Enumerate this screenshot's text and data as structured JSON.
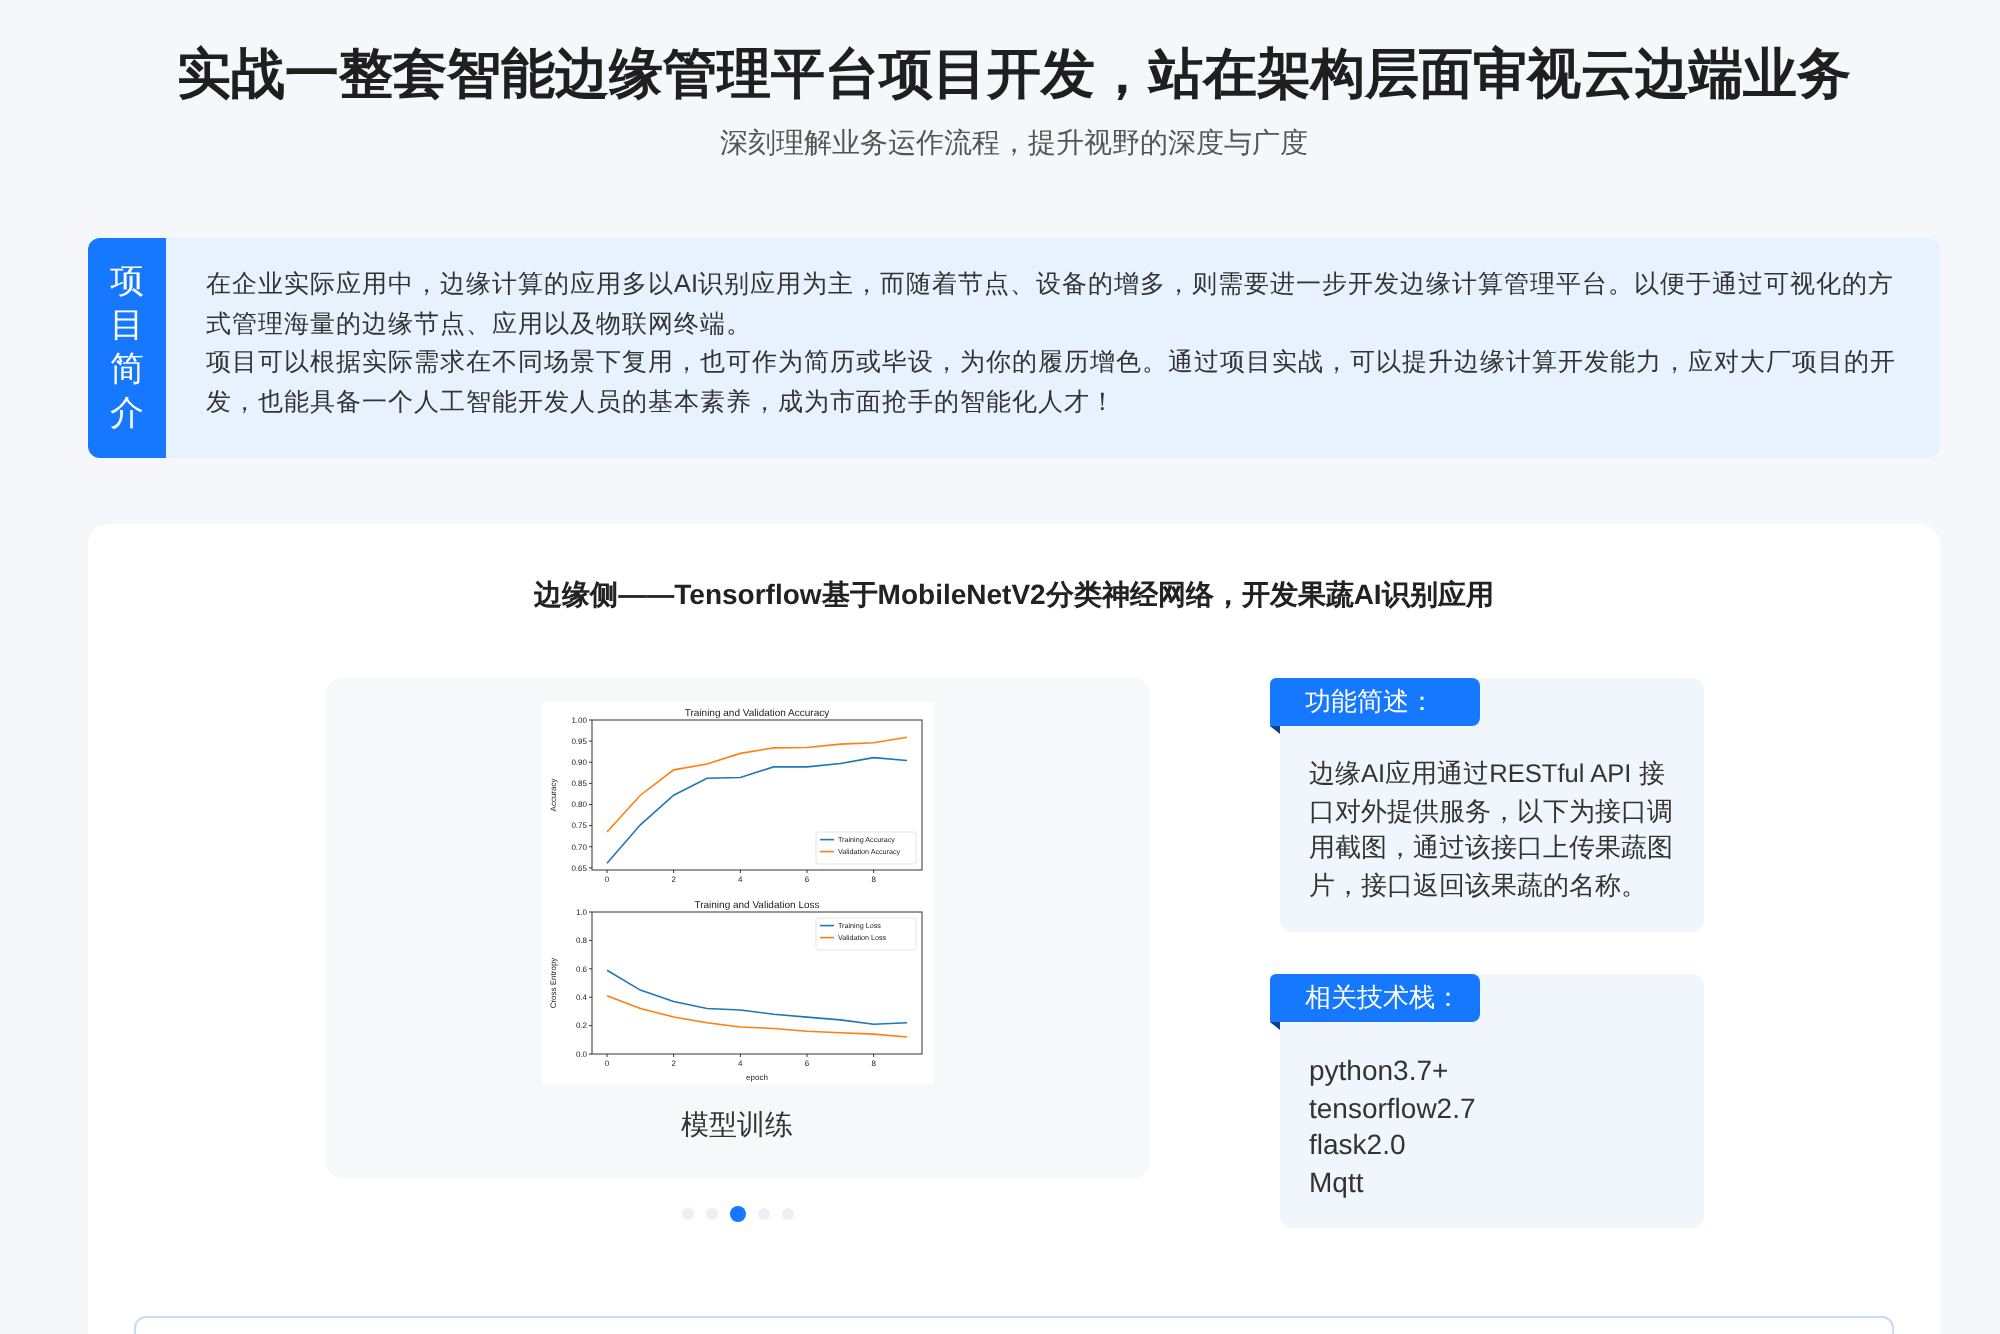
{
  "header": {
    "title": "实战一整套智能边缘管理平台项目开发，站在架构层面审视云边端业务",
    "subtitle": "深刻理解业务运作流程，提升视野的深度与广度"
  },
  "intro": {
    "label": "项目简介",
    "paragraphs": [
      "在企业实际应用中，边缘计算的应用多以AI识别应用为主，而随着节点、设备的增多，则需要进一步开发边缘计算管理平台。以便于通过可视化的方式管理海量的边缘节点、应用以及物联网终端。",
      "项目可以根据实际需求在不同场景下复用，也可作为简历或毕设，为你的履历增色。通过项目实战，可以提升边缘计算开发能力，应对大厂项目的开发，也能具备一个人工智能开发人员的基本素养，成为市面抢手的智能化人才！"
    ]
  },
  "section": {
    "title": "边缘侧——Tensorflow基于MobileNetV2分类神经网络，开发果蔬AI识别应用",
    "slide": {
      "charts": [
        {
          "chart_data": {
            "type": "line",
            "title": "Training and Validation Accuracy",
            "ylabel": "Accuracy",
            "x": [
              0,
              1,
              2,
              3,
              4,
              5,
              6,
              7,
              8,
              9
            ],
            "series": [
              {
                "name": "Training Accuracy",
                "color": "#1f77b4",
                "values": [
                  0.661,
                  0.752,
                  0.822,
                  0.862,
                  0.864,
                  0.889,
                  0.889,
                  0.897,
                  0.911,
                  0.904
                ]
              },
              {
                "name": "Validation Accuracy",
                "color": "#ff7f0e",
                "values": [
                  0.735,
                  0.822,
                  0.882,
                  0.896,
                  0.921,
                  0.934,
                  0.935,
                  0.943,
                  0.946,
                  0.959
                ]
              }
            ],
            "legend": "lower right",
            "xlim": [
              -0.45,
              9.45
            ],
            "ylim": [
              0.645,
              1.0
            ],
            "xticks": [
              0,
              2,
              4,
              6,
              8
            ],
            "yticks": [
              {
                "value": 0.65,
                "label": "0.65"
              },
              {
                "value": 0.7,
                "label": "0.70"
              },
              {
                "value": 0.75,
                "label": "0.75"
              },
              {
                "value": 0.8,
                "label": "0.80"
              },
              {
                "value": 0.85,
                "label": "0.85"
              },
              {
                "value": 0.9,
                "label": "0.90"
              },
              {
                "value": 0.95,
                "label": "0.95"
              },
              {
                "value": 1.0,
                "label": "1.00"
              }
            ]
          }
        },
        {
          "chart_data": {
            "type": "line",
            "title": "Training and Validation Loss",
            "xlabel": "epoch",
            "ylabel": "Cross Entropy",
            "x": [
              0,
              1,
              2,
              3,
              4,
              5,
              6,
              7,
              8,
              9
            ],
            "series": [
              {
                "name": "Training Loss",
                "color": "#1f77b4",
                "values": [
                  0.59,
                  0.45,
                  0.37,
                  0.32,
                  0.31,
                  0.28,
                  0.26,
                  0.24,
                  0.21,
                  0.22
                ]
              },
              {
                "name": "Validation Loss",
                "color": "#ff7f0e",
                "values": [
                  0.41,
                  0.32,
                  0.26,
                  0.22,
                  0.19,
                  0.18,
                  0.16,
                  0.15,
                  0.14,
                  0.12
                ]
              }
            ],
            "legend": "upper right",
            "xlim": [
              -0.45,
              9.45
            ],
            "ylim": [
              0,
              1.0
            ],
            "xticks": [
              0,
              2,
              4,
              6,
              8
            ],
            "yticks": [
              {
                "value": 0,
                "label": "0.0"
              },
              {
                "value": 0.2,
                "label": "0.2"
              },
              {
                "value": 0.4,
                "label": "0.4"
              },
              {
                "value": 0.6,
                "label": "0.6"
              },
              {
                "value": 0.8,
                "label": "0.8"
              },
              {
                "value": 1.0,
                "label": "1.0"
              }
            ]
          }
        }
      ],
      "caption": "模型训练"
    },
    "indicators": [
      {
        "selected": false
      },
      {
        "selected": false
      },
      {
        "selected": true
      },
      {
        "selected": false
      },
      {
        "selected": false
      }
    ],
    "panels": [
      {
        "kind": "text",
        "label": "功能简述：",
        "text": "边缘AI应用通过RESTful API 接口对外提供服务，以下为接口调用截图，通过该接口上传果蔬图片，接口返回该果蔬的名称。"
      },
      {
        "kind": "list",
        "label": "相关技术栈：",
        "items": [
          "python3.7+",
          "tensorflow2.7",
          "flask2.0",
          "Mqtt"
        ]
      }
    ]
  }
}
